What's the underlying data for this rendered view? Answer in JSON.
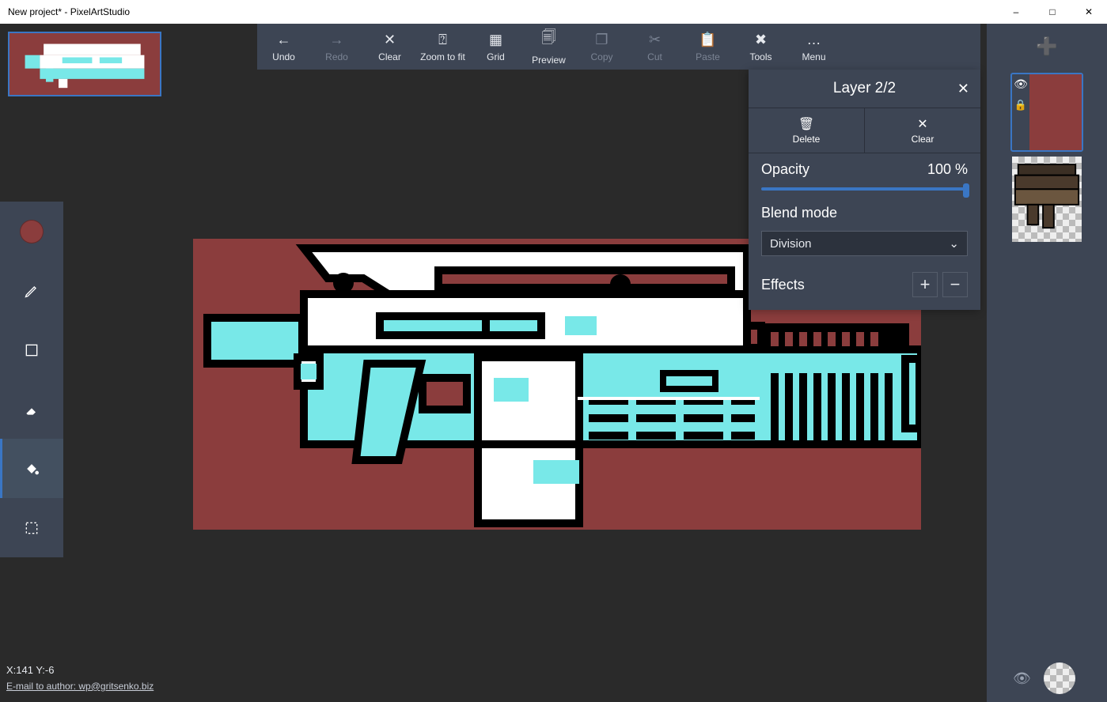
{
  "window": {
    "title": "New project* - PixelArtStudio"
  },
  "toolbar": [
    {
      "id": "undo",
      "label": "Undo",
      "enabled": true
    },
    {
      "id": "redo",
      "label": "Redo",
      "enabled": false
    },
    {
      "id": "clear",
      "label": "Clear",
      "enabled": true
    },
    {
      "id": "zoomfit",
      "label": "Zoom to fit",
      "enabled": true
    },
    {
      "id": "grid",
      "label": "Grid",
      "enabled": true
    },
    {
      "id": "preview",
      "label": "Preview",
      "enabled": true
    },
    {
      "id": "copy",
      "label": "Copy",
      "enabled": false
    },
    {
      "id": "cut",
      "label": "Cut",
      "enabled": false
    },
    {
      "id": "paste",
      "label": "Paste",
      "enabled": false
    },
    {
      "id": "tools",
      "label": "Tools",
      "enabled": true
    },
    {
      "id": "menu",
      "label": "Menu",
      "enabled": true
    }
  ],
  "left_tools": [
    {
      "id": "color",
      "active": false
    },
    {
      "id": "pencil",
      "active": false
    },
    {
      "id": "rect",
      "active": false
    },
    {
      "id": "eraser",
      "active": false
    },
    {
      "id": "bucket",
      "active": true
    },
    {
      "id": "select",
      "active": false
    }
  ],
  "colors": {
    "primary": "#8b3d3d",
    "accent": "#3a76c4",
    "cyan": "#78e8e8",
    "bg": "#8b3d3d"
  },
  "layer_panel": {
    "title": "Layer 2/2",
    "delete": "Delete",
    "clear": "Clear",
    "opacity_label": "Opacity",
    "opacity_value": "100 %",
    "blend_label": "Blend mode",
    "blend_value": "Division",
    "effects_label": "Effects"
  },
  "layers": [
    {
      "id": 2,
      "selected": true,
      "bg": "#8b3d3d",
      "visible": true,
      "locked": true
    },
    {
      "id": 1,
      "selected": false,
      "bg": "checker",
      "visible": true,
      "locked": false
    }
  ],
  "status": {
    "coords": "X:141 Y:-6",
    "email": "E-mail to author: wp@gritsenko.biz"
  }
}
